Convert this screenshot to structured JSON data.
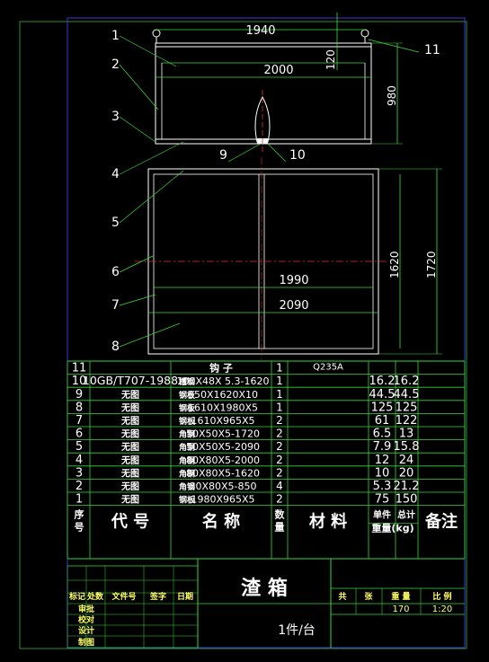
{
  "colors": {
    "background": "#000000",
    "frame": "#2e8b2e",
    "geometry": "#ffffff",
    "dimension": "#3cdc3c",
    "centerline": "#e03030",
    "table_line": "#34d834",
    "text": "#ffffff",
    "label_yellow": "#ffff66"
  },
  "dimensions": {
    "top_1940": "1940",
    "top_2000": "2000",
    "v_120": "120",
    "v_980": "980",
    "h_1990": "1990",
    "h_2090": "2090",
    "v_1620": "1620",
    "v_1720": "1720"
  },
  "balloons": [
    "1",
    "2",
    "3",
    "4",
    "5",
    "6",
    "7",
    "8",
    "9",
    "10",
    "11"
  ],
  "bom": {
    "header": {
      "no_line1": "序",
      "no_line2": "号",
      "code": "代  号",
      "name": "名  称",
      "qty_line1": "数",
      "qty_line2": "量",
      "material": "材  料",
      "unit_weight": "单件",
      "total_weight": "总计",
      "weight_label": "重量(kg)",
      "remark": "备注"
    },
    "rows": [
      {
        "no": "11",
        "code": "",
        "name_main": "钩  子",
        "name_sub": "",
        "qty": "1",
        "material": "Q235A",
        "unit": "",
        "total": ""
      },
      {
        "no": "10",
        "code": "10GB/T707-1988",
        "name_main": "槽钢",
        "name_sub": "100X48X 5.3-1620",
        "qty": "1",
        "material": "",
        "unit": "16.2",
        "total": "16.2"
      },
      {
        "no": "9",
        "code": "无图",
        "name_main": "钢板",
        "name_sub": "350X1620X10",
        "qty": "1",
        "material": "",
        "unit": "44.5",
        "total": "44.5"
      },
      {
        "no": "8",
        "code": "无图",
        "name_main": "钢板",
        "name_sub": "1610X1980X5",
        "qty": "1",
        "material": "",
        "unit": "125",
        "total": "125"
      },
      {
        "no": "7",
        "code": "无图",
        "name_main": "钢板",
        "name_sub": "1610X965X5",
        "qty": "2",
        "material": "",
        "unit": "61",
        "total": "122"
      },
      {
        "no": "6",
        "code": "无图",
        "name_main": "角钢",
        "name_sub": "50X50X5-1720",
        "qty": "2",
        "material": "",
        "unit": "6.5",
        "total": "13"
      },
      {
        "no": "5",
        "code": "无图",
        "name_main": "角钢",
        "name_sub": "50X50X5-2090",
        "qty": "2",
        "material": "",
        "unit": "7.9",
        "total": "15.8"
      },
      {
        "no": "4",
        "code": "无图",
        "name_main": "角钢",
        "name_sub": "80X80X5-2000",
        "qty": "2",
        "material": "",
        "unit": "12",
        "total": "24"
      },
      {
        "no": "3",
        "code": "无图",
        "name_main": "角钢",
        "name_sub": "80X80X5-1620",
        "qty": "2",
        "material": "",
        "unit": "10",
        "total": "20"
      },
      {
        "no": "2",
        "code": "无图",
        "name_main": "角钢",
        "name_sub": "80X80X5-850",
        "qty": "4",
        "material": "",
        "unit": "5.3",
        "total": "21.2"
      },
      {
        "no": "1",
        "code": "无图",
        "name_main": "钢板",
        "name_sub": "1980X965X5",
        "qty": "2",
        "material": "",
        "unit": "75",
        "total": "150"
      }
    ]
  },
  "title_block": {
    "title": "渣  箱",
    "quantity": "1件/台",
    "col_labels": [
      "标记",
      "处数",
      "文件号",
      "签字",
      "日期"
    ],
    "row_labels": [
      "审批",
      "校对",
      "设计",
      "制图"
    ],
    "sheet_labels": [
      "共",
      "张",
      "重  量",
      "比  例"
    ],
    "weight": "170",
    "scale": "1:20"
  }
}
